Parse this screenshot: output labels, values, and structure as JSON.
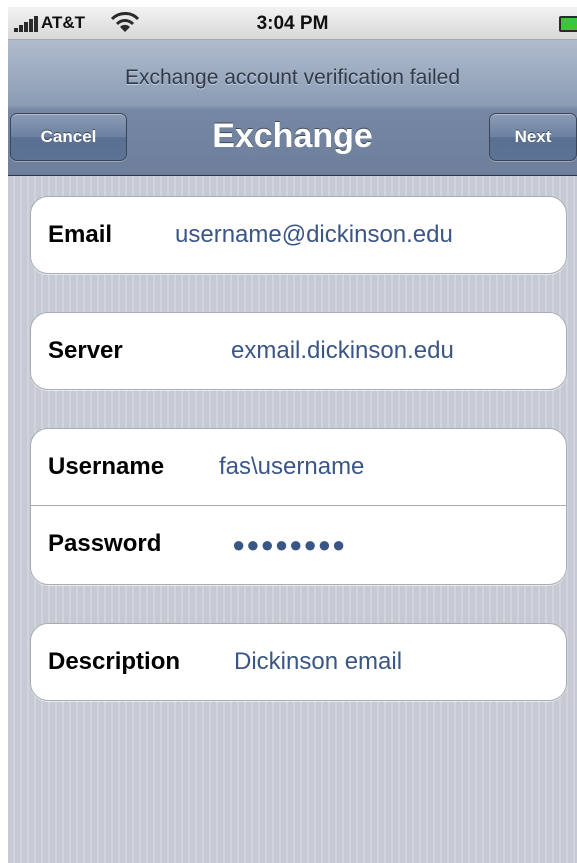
{
  "status_bar": {
    "carrier": "AT&T",
    "time": "3:04 PM",
    "signal_icon": "signal-bars-icon",
    "wifi_icon": "wifi-icon",
    "battery_icon": "battery-icon"
  },
  "nav": {
    "prompt": "Exchange account verification failed",
    "title": "Exchange",
    "cancel_label": "Cancel",
    "next_label": "Next"
  },
  "form": {
    "email": {
      "label": "Email",
      "value": "username@dickinson.edu"
    },
    "server": {
      "label": "Server",
      "value": "exmail.dickinson.edu"
    },
    "username": {
      "label": "Username",
      "value": "fas\\username"
    },
    "password": {
      "label": "Password",
      "value": "●●●●●●●●"
    },
    "description": {
      "label": "Description",
      "value": "Dickinson email"
    }
  },
  "colors": {
    "nav_bar": "#7f91ab",
    "field_value": "#3a5686",
    "background_stripes": "#c7ccd6",
    "battery": "#3dc63d"
  }
}
